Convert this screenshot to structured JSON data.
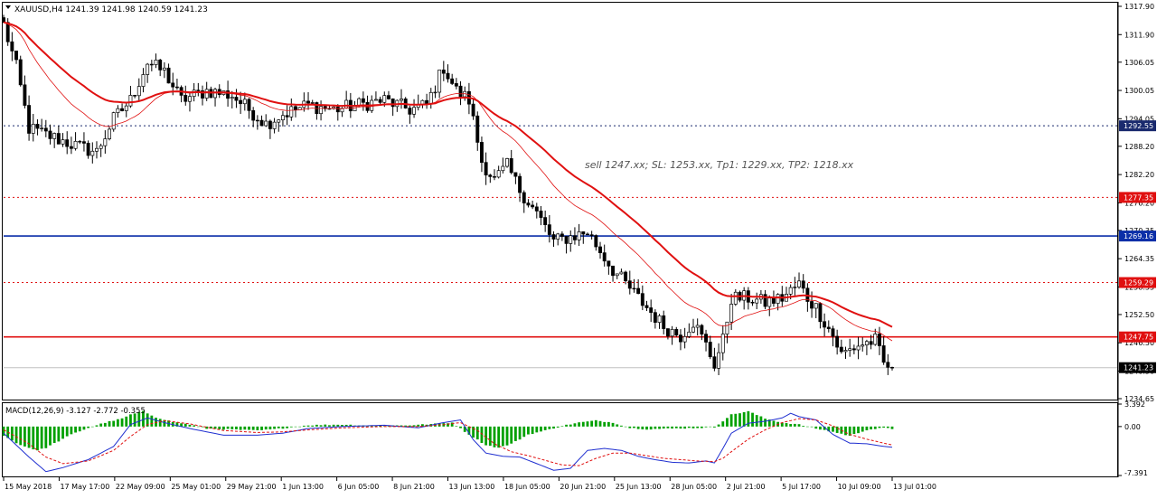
{
  "window": {
    "symbol_line": "XAUUSD,H4  1241.39 1241.98 1240.59 1241.23",
    "annotation": "sell 1247.xx; SL: 1253.xx, Tp1: 1229.xx, TP2: 1218.xx"
  },
  "colors": {
    "background": "#ffffff",
    "frame": "#000000",
    "candle": "#000000",
    "ma_slow": "#e01010",
    "ma_fast": "#e01010",
    "blue_line": "#0b2fa8",
    "red_line": "#e01010",
    "dotted_red": "#e01010",
    "dotted_navy": "#1a2a6e",
    "macd_hist": "#00a000",
    "macd_line": "#1f2fd0",
    "signal_line": "#e01010"
  },
  "price_axis": {
    "labels": [
      "1317.90",
      "1311.90",
      "1306.05",
      "1300.05",
      "1294.05",
      "1288.20",
      "1282.20",
      "1276.20",
      "1270.35",
      "1264.35",
      "1258.35",
      "1252.50",
      "1246.50",
      "1240.50",
      "1234.65"
    ],
    "ylim": [
      1234.65,
      1317.9
    ]
  },
  "levels": [
    {
      "label": "1292.55",
      "value": 1292.55,
      "style": "dotted",
      "color": "#1a2a6e"
    },
    {
      "label": "1277.35",
      "value": 1277.35,
      "style": "dotted",
      "color": "#e01010"
    },
    {
      "label": "1269.16",
      "value": 1269.16,
      "style": "solid",
      "color": "#0b2fa8"
    },
    {
      "label": "1259.29",
      "value": 1259.29,
      "style": "dotted",
      "color": "#e01010"
    },
    {
      "label": "1247.75",
      "value": 1247.75,
      "style": "solid",
      "color": "#e01010"
    }
  ],
  "current_price": {
    "label": "1241.23",
    "value": 1241.23
  },
  "time_axis": [
    "15 May 2018",
    "17 May 17:00",
    "22 May 09:00",
    "25 May 01:00",
    "29 May 21:00",
    "1 Jun 13:00",
    "6 Jun 05:00",
    "8 Jun 21:00",
    "13 Jun 13:00",
    "18 Jun 05:00",
    "20 Jun 21:00",
    "25 Jun 13:00",
    "28 Jun 05:00",
    "2 Jul 21:00",
    "5 Jul 17:00",
    "10 Jul 09:00",
    "13 Jul 01:00"
  ],
  "macd": {
    "label": "MACD(12,26,9) -3.127 -2.772 -0.355",
    "axis_labels": [
      "3.392",
      "0.00",
      "-7.391"
    ],
    "ylim": [
      -7.391,
      3.392
    ]
  },
  "chart_data": {
    "type": "candlestick",
    "symbol": "XAUUSD",
    "timeframe": "H4",
    "ylim": [
      1234.65,
      1317.9
    ],
    "close_path": [
      [
        0,
        1314
      ],
      [
        3,
        1305
      ],
      [
        6,
        1292
      ],
      [
        12,
        1290
      ],
      [
        18,
        1288
      ],
      [
        22,
        1287
      ],
      [
        26,
        1294
      ],
      [
        30,
        1298
      ],
      [
        34,
        1306
      ],
      [
        38,
        1304
      ],
      [
        42,
        1298
      ],
      [
        48,
        1300
      ],
      [
        54,
        1299
      ],
      [
        58,
        1296
      ],
      [
        62,
        1293
      ],
      [
        66,
        1295
      ],
      [
        72,
        1297
      ],
      [
        78,
        1296
      ],
      [
        84,
        1297
      ],
      [
        90,
        1298
      ],
      [
        96,
        1296
      ],
      [
        100,
        1297
      ],
      [
        104,
        1305
      ],
      [
        107,
        1300
      ],
      [
        110,
        1298
      ],
      [
        113,
        1285
      ],
      [
        116,
        1281
      ],
      [
        119,
        1284
      ],
      [
        122,
        1279
      ],
      [
        126,
        1274
      ],
      [
        130,
        1268
      ],
      [
        134,
        1269
      ],
      [
        138,
        1270
      ],
      [
        141,
        1266
      ],
      [
        144,
        1262
      ],
      [
        148,
        1258
      ],
      [
        152,
        1254
      ],
      [
        156,
        1250
      ],
      [
        160,
        1248
      ],
      [
        163,
        1251
      ],
      [
        166,
        1246
      ],
      [
        168,
        1242
      ],
      [
        170,
        1247
      ],
      [
        172,
        1256
      ],
      [
        176,
        1256
      ],
      [
        180,
        1255
      ],
      [
        184,
        1256
      ],
      [
        188,
        1259
      ],
      [
        190,
        1256
      ],
      [
        192,
        1254
      ],
      [
        194,
        1251
      ],
      [
        196,
        1248
      ],
      [
        198,
        1244
      ],
      [
        202,
        1246
      ],
      [
        206,
        1247
      ],
      [
        208,
        1242
      ],
      [
        210,
        1241.23
      ]
    ],
    "macd_hist_path": [
      [
        0,
        -1.4
      ],
      [
        4,
        -2.8
      ],
      [
        8,
        -3.6
      ],
      [
        10,
        -3.2
      ],
      [
        13,
        -2.2
      ],
      [
        16,
        -1.2
      ],
      [
        20,
        -0.2
      ],
      [
        24,
        0.6
      ],
      [
        28,
        1.2
      ],
      [
        30,
        1.8
      ],
      [
        33,
        2.3
      ],
      [
        36,
        1.4
      ],
      [
        40,
        0.7
      ],
      [
        44,
        0.3
      ],
      [
        48,
        -0.3
      ],
      [
        56,
        -0.5
      ],
      [
        60,
        -0.6
      ],
      [
        64,
        -0.4
      ],
      [
        68,
        -0.1
      ],
      [
        72,
        0.2
      ],
      [
        80,
        0.3
      ],
      [
        88,
        0.1
      ],
      [
        96,
        0.2
      ],
      [
        102,
        0.4
      ],
      [
        106,
        0.6
      ],
      [
        110,
        -1.2
      ],
      [
        114,
        -2.8
      ],
      [
        117,
        -3.2
      ],
      [
        120,
        -2.6
      ],
      [
        124,
        -1.2
      ],
      [
        128,
        -0.6
      ],
      [
        132,
        0.1
      ],
      [
        136,
        0.6
      ],
      [
        140,
        0.9
      ],
      [
        144,
        0.6
      ],
      [
        148,
        -0.2
      ],
      [
        152,
        -0.4
      ],
      [
        158,
        -0.3
      ],
      [
        164,
        -0.2
      ],
      [
        168,
        -0.1
      ],
      [
        172,
        1.8
      ],
      [
        176,
        2.3
      ],
      [
        180,
        1.2
      ],
      [
        184,
        0.6
      ],
      [
        188,
        0.3
      ],
      [
        192,
        -0.3
      ],
      [
        196,
        -0.8
      ],
      [
        200,
        -1.4
      ],
      [
        204,
        -0.5
      ],
      [
        208,
        -0.2
      ],
      [
        210,
        -0.355
      ]
    ],
    "macd_line_path": [
      [
        0,
        -1
      ],
      [
        6,
        -4.6
      ],
      [
        10,
        -6.8
      ],
      [
        14,
        -6.2
      ],
      [
        20,
        -5
      ],
      [
        26,
        -3
      ],
      [
        30,
        0.3
      ],
      [
        34,
        1.3
      ],
      [
        38,
        0.6
      ],
      [
        44,
        -0.3
      ],
      [
        52,
        -1.3
      ],
      [
        60,
        -1.3
      ],
      [
        66,
        -1.0
      ],
      [
        72,
        -0.3
      ],
      [
        80,
        0.0
      ],
      [
        90,
        0.2
      ],
      [
        98,
        -0.2
      ],
      [
        104,
        0.6
      ],
      [
        108,
        1.0
      ],
      [
        111,
        -2
      ],
      [
        114,
        -4.0
      ],
      [
        118,
        -4.5
      ],
      [
        122,
        -4.6
      ],
      [
        126,
        -5.6
      ],
      [
        130,
        -6.6
      ],
      [
        134,
        -6.3
      ],
      [
        138,
        -3.6
      ],
      [
        142,
        -3.3
      ],
      [
        146,
        -3.6
      ],
      [
        150,
        -4.5
      ],
      [
        154,
        -5
      ],
      [
        158,
        -5.4
      ],
      [
        162,
        -5.5
      ],
      [
        166,
        -5.2
      ],
      [
        168,
        -5.5
      ],
      [
        170,
        -3.3
      ],
      [
        172,
        -1
      ],
      [
        176,
        0.5
      ],
      [
        180,
        0.8
      ],
      [
        184,
        1.3
      ],
      [
        186,
        2.0
      ],
      [
        188,
        1.5
      ],
      [
        192,
        1.0
      ],
      [
        196,
        -1.2
      ],
      [
        200,
        -2.5
      ],
      [
        204,
        -2.6
      ],
      [
        208,
        -3.0
      ],
      [
        210,
        -3.127
      ]
    ],
    "signal_line_path": [
      [
        0,
        -0.5
      ],
      [
        6,
        -2.6
      ],
      [
        10,
        -4.6
      ],
      [
        14,
        -5.6
      ],
      [
        20,
        -5.2
      ],
      [
        26,
        -3.6
      ],
      [
        30,
        -1.5
      ],
      [
        34,
        0.3
      ],
      [
        38,
        0.9
      ],
      [
        44,
        0.4
      ],
      [
        52,
        -0.6
      ],
      [
        60,
        -0.9
      ],
      [
        66,
        -0.8
      ],
      [
        72,
        -0.5
      ],
      [
        80,
        -0.2
      ],
      [
        90,
        0.0
      ],
      [
        98,
        0.0
      ],
      [
        104,
        0.3
      ],
      [
        108,
        0.6
      ],
      [
        112,
        -0.6
      ],
      [
        116,
        -2.6
      ],
      [
        120,
        -3.8
      ],
      [
        124,
        -4.4
      ],
      [
        128,
        -5.1
      ],
      [
        132,
        -5.8
      ],
      [
        136,
        -5.9
      ],
      [
        140,
        -4.8
      ],
      [
        144,
        -4.0
      ],
      [
        148,
        -4.0
      ],
      [
        152,
        -4.4
      ],
      [
        156,
        -4.8
      ],
      [
        160,
        -5.0
      ],
      [
        164,
        -5.2
      ],
      [
        168,
        -5.3
      ],
      [
        170,
        -4.8
      ],
      [
        172,
        -3.8
      ],
      [
        176,
        -1.9
      ],
      [
        180,
        -0.5
      ],
      [
        184,
        0.6
      ],
      [
        188,
        1.2
      ],
      [
        192,
        1.0
      ],
      [
        196,
        0.1
      ],
      [
        200,
        -1.2
      ],
      [
        204,
        -1.9
      ],
      [
        208,
        -2.5
      ],
      [
        210,
        -2.772
      ]
    ]
  }
}
